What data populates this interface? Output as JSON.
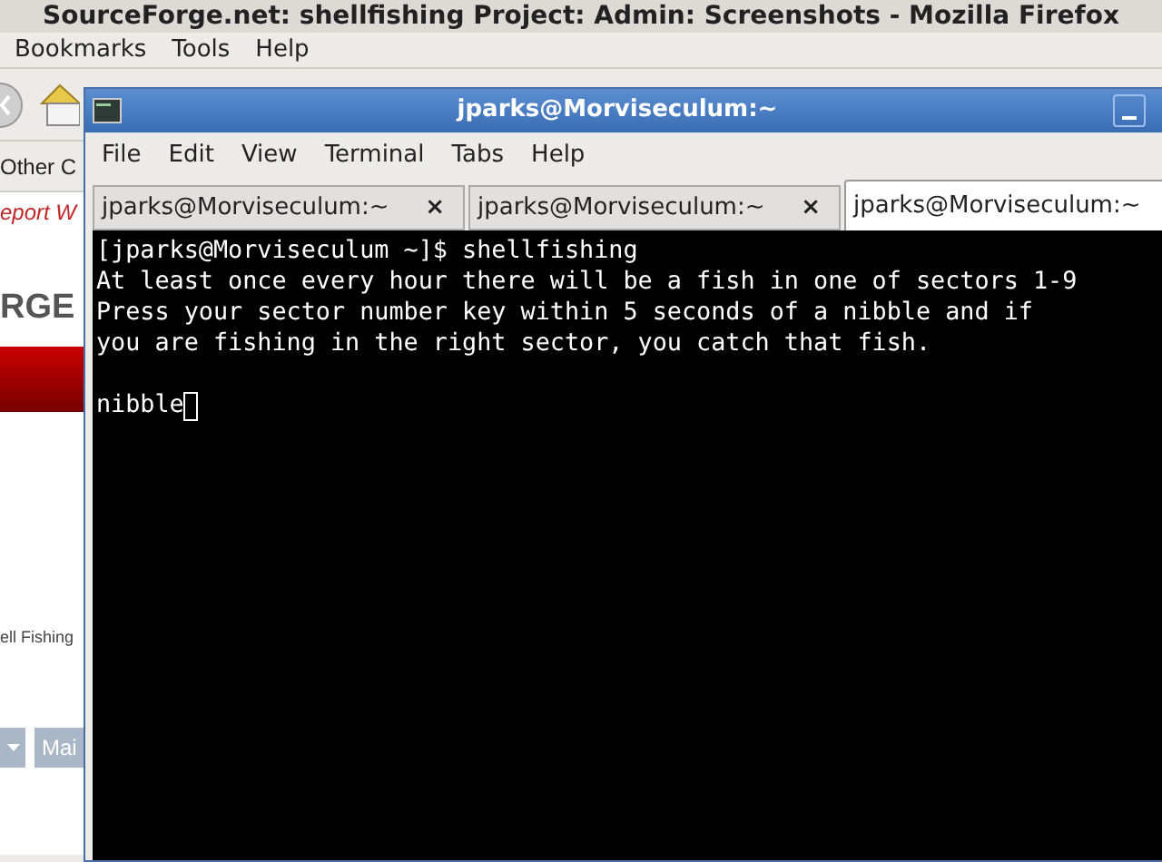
{
  "browser": {
    "title": "SourceForge.net: shellfishing Project: Admin: Screenshots - Mozilla Firefox",
    "menu": [
      "Bookmarks",
      "Tools",
      "Help"
    ],
    "bookmarks": [
      "Other C"
    ],
    "page": {
      "notice": "eport W",
      "logo": "RGE",
      "project": "ell Fishing",
      "tab_button": "Mai"
    }
  },
  "terminal": {
    "title": "jparks@Morviseculum:~",
    "menu": [
      "File",
      "Edit",
      "View",
      "Terminal",
      "Tabs",
      "Help"
    ],
    "tabs": [
      {
        "label": "jparks@Morviseculum:~",
        "selected": false,
        "close": "×"
      },
      {
        "label": "jparks@Morviseculum:~",
        "selected": false,
        "close": "×"
      },
      {
        "label": "jparks@Morviseculum:~",
        "selected": true
      }
    ],
    "lines": [
      "[jparks@Morviseculum ~]$ shellfishing",
      "At least once every hour there will be a fish in one of sectors 1-9",
      "Press your sector number key within 5 seconds of a nibble and if",
      "you are fishing in the right sector, you catch that fish."
    ],
    "current_line": "nibble"
  }
}
